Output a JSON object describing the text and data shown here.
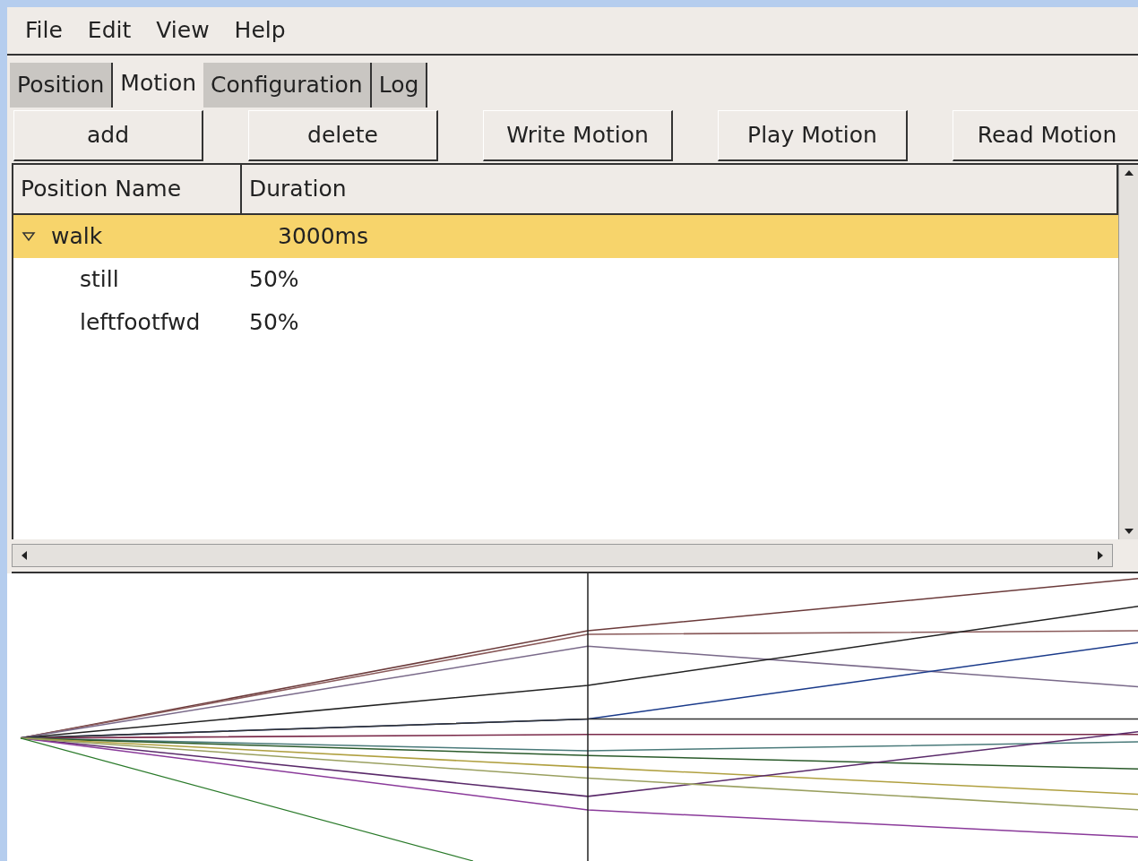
{
  "menu": [
    "File",
    "Edit",
    "View",
    "Help"
  ],
  "tabs": [
    {
      "label": "Position",
      "selected": false
    },
    {
      "label": "Motion",
      "selected": true
    },
    {
      "label": "Configuration",
      "selected": false
    },
    {
      "label": "Log",
      "selected": false
    }
  ],
  "buttons": [
    "add",
    "delete",
    "Write Motion",
    "Play Motion",
    "Read Motion"
  ],
  "tree": {
    "columns": [
      "Position Name",
      "Duration"
    ],
    "rows": [
      {
        "name": "walk",
        "duration": "3000ms",
        "selected": true,
        "expanded": true,
        "children": [
          {
            "name": "still",
            "duration": "50%",
            "selected": false
          },
          {
            "name": "leftfootfwd",
            "duration": "50%",
            "selected": false
          }
        ]
      }
    ]
  }
}
